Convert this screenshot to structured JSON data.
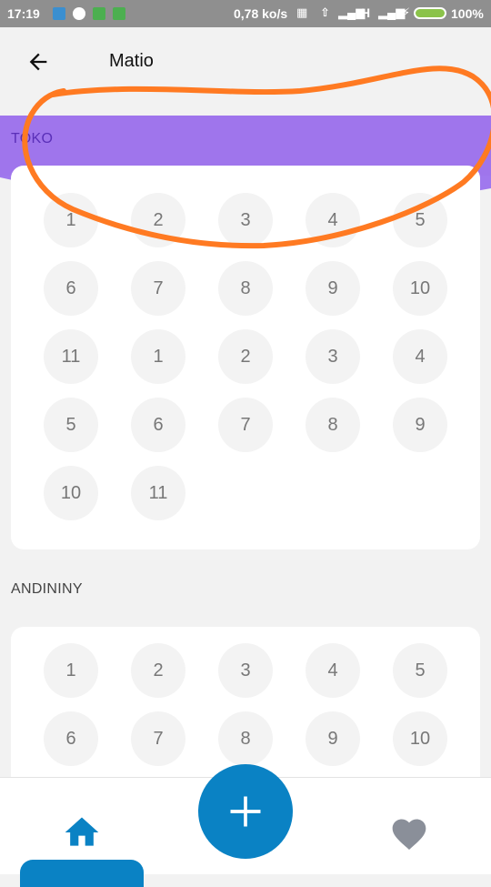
{
  "status_bar": {
    "time": "17:19",
    "net_speed": "0,78 ko/s",
    "network_type": "H",
    "battery": "100%",
    "icons": [
      "usb-icon",
      "app-icon",
      "app-icon",
      "app-icon",
      "vibrate-icon",
      "bluetooth-icon",
      "signal-icon",
      "signal-icon",
      "charging-icon",
      "battery-icon"
    ]
  },
  "header": {
    "title": "Matio",
    "back_icon": "arrow-left-icon"
  },
  "sections": [
    {
      "label": "TOKO",
      "numbers": [
        "1",
        "2",
        "3",
        "4",
        "5",
        "6",
        "7",
        "8",
        "9",
        "10",
        "11",
        "1",
        "2",
        "3",
        "4",
        "5",
        "6",
        "7",
        "8",
        "9",
        "10",
        "11"
      ]
    },
    {
      "label": "ANDININY",
      "numbers": [
        "1",
        "2",
        "3",
        "4",
        "5",
        "6",
        "7",
        "8",
        "9",
        "10"
      ]
    }
  ],
  "bottom_nav": {
    "home_icon": "home-icon",
    "add_icon": "plus-icon",
    "favorite_icon": "heart-icon"
  },
  "colors": {
    "accent": "#0a82c4",
    "purple": "#a078ee",
    "annotation": "#ff7a22",
    "status_bar": "#8f8f8f"
  }
}
